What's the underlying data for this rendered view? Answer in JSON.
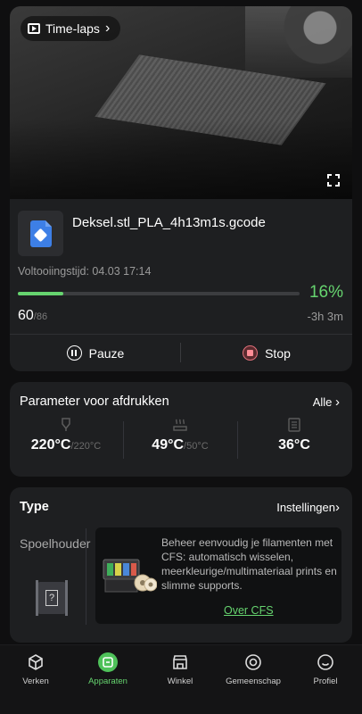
{
  "camera": {
    "timelapse_label": "Time-laps",
    "timelapse_chevron": "›"
  },
  "job": {
    "file_name": "Deksel.stl_PLA_4h13m1s.gcode",
    "completion_label": "Voltooiingstijd: 04.03 17:14",
    "progress": 0.16,
    "progress_text": "16%",
    "layer_current": "60",
    "layer_total": "/86",
    "remaining": "-3h 3m",
    "pause_label": "Pauze",
    "stop_label": "Stop",
    "progress_color": "#66d46f"
  },
  "params": {
    "title": "Parameter voor afdrukken",
    "all_label": "Alle",
    "chevron": "›",
    "temps": [
      {
        "value": "220°C",
        "target": "/220°C",
        "icon": "nozzle-icon"
      },
      {
        "value": "49°C",
        "target": "/50°C",
        "icon": "heatbed-icon"
      },
      {
        "value": "36°C",
        "target": "",
        "icon": "chamber-icon"
      }
    ]
  },
  "type_card": {
    "title": "Type",
    "settings_label": "Instellingen",
    "chevron": "›",
    "spool_label": "Spoelhouder",
    "spool_slot": "?",
    "cfs_text": "Beheer eenvoudig je filamenten met CFS: automatisch wisselen, meerkleurige/multimateriaal prints en slimme supports.",
    "cfs_link": "Over CFS"
  },
  "nav": {
    "items": [
      {
        "label": "Verken",
        "icon": "cube-icon",
        "active": false
      },
      {
        "label": "Apparaten",
        "icon": "devices-icon",
        "active": true
      },
      {
        "label": "Winkel",
        "icon": "shop-icon",
        "active": false
      },
      {
        "label": "Gemeenschap",
        "icon": "community-icon",
        "active": false
      },
      {
        "label": "Profiel",
        "icon": "profile-icon",
        "active": false
      }
    ]
  }
}
